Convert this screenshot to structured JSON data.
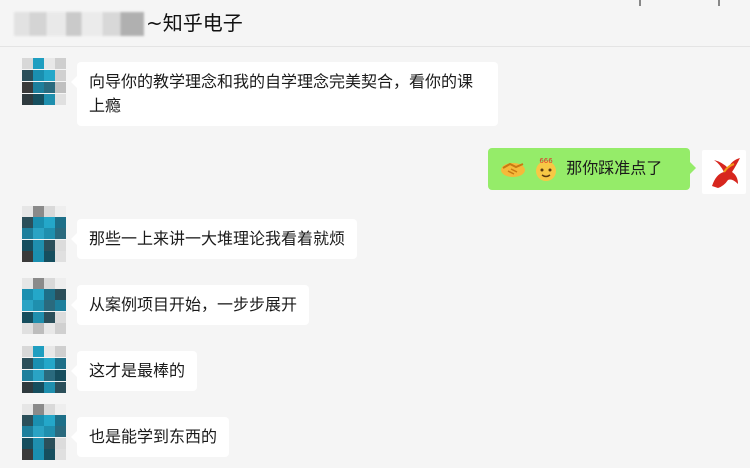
{
  "header": {
    "title": "~知乎电子",
    "blurred_name": "redacted"
  },
  "messages": [
    {
      "side": "in",
      "text": "向导你的教学理念和我的自学理念完美契合，看你的课上瘾"
    },
    {
      "side": "out",
      "emojis": [
        "handshake-icon",
        "666-face-icon"
      ],
      "text": "那你踩准点了"
    },
    {
      "side": "in",
      "text": "那些一上来讲一大堆理论我看着就烦"
    },
    {
      "side": "in",
      "text": "从案例项目开始，一步步展开"
    },
    {
      "side": "in",
      "text": "这才是最棒的"
    },
    {
      "side": "in",
      "text": "也是能学到东西的"
    }
  ],
  "colors": {
    "background": "#f5f5f5",
    "incoming_bubble": "#ffffff",
    "outgoing_bubble": "#95ec69",
    "avatar_teal": "#1f8fae"
  }
}
